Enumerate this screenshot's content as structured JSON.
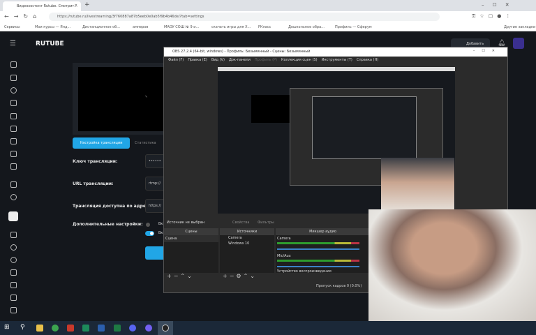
{
  "browser": {
    "tab_title": "Видеохостинг Rutube. Смотрит...",
    "url": "https://rutube.ru/livestreaming/3f760887a87b5eeb0e0ab5f9b4b46de/?tab=settings",
    "bookmarks": [
      "Сервисы",
      "Мои курсы — Янд...",
      "Дистанционное об...",
      "амперов",
      "МАОУ СОШ № 9 и...",
      "скачать игры для Х...",
      "РКласс",
      "Дошкольное обра...",
      "Профиль — Сферум"
    ],
    "other_bookmarks": "Другие закладки"
  },
  "rutube": {
    "logo": "RUTUBE",
    "add_button": "Добавить",
    "tabs": [
      "Настройка трансляции",
      "Статистика"
    ],
    "fields": [
      {
        "label": "Ключ трансляции:",
        "value": "••••••"
      },
      {
        "label": "URL трансляции:",
        "value": "rtmp://"
      },
      {
        "label": "Трансляция доступна по адресу:",
        "value": "https://"
      }
    ],
    "extra_label": "Дополнительные настройки:",
    "toggle1": "Вк",
    "toggle2": "Вк"
  },
  "obs": {
    "title": "OBS 27.2.4 (64-bit, windows) - Профиль: Безымянный - Сцены: Безымянный",
    "menu": [
      "Файл (F)",
      "Правка (E)",
      "Вид (V)",
      "Док-панели",
      "Профиль (P)",
      "Коллекция сцен (S)",
      "Инструменты (T)",
      "Справка (H)"
    ],
    "no_source": "Источник не выбран",
    "properties": "Свойства",
    "filters": "Фильтры",
    "scenes_header": "Сцены",
    "sources_header": "Источники",
    "mixer_header": "Микшер аудио",
    "scenes": [
      "Сцена"
    ],
    "sources": [
      "Camera",
      "Windows 10"
    ],
    "mixer": [
      "Camera",
      "Mic/Aux",
      "Устройство воспроизведения"
    ],
    "status": "Пропуск кадров 0 (0.0%)"
  }
}
